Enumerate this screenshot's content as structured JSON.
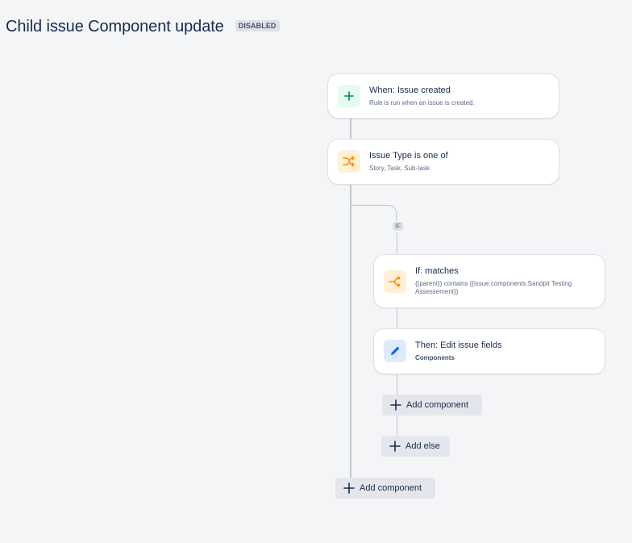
{
  "header": {
    "title": "Child issue Component update",
    "status": "DISABLED"
  },
  "flow": {
    "trigger": {
      "title": "When: Issue created",
      "subtitle": "Rule is run when an issue is created.",
      "icon": "plus-icon",
      "icon_color": "#00875a"
    },
    "condition": {
      "title": "Issue Type is one of",
      "subtitle": "Story, Task, Sub-task",
      "icon": "shuffle-icon",
      "icon_color": "#ff8b00"
    },
    "if_branch": {
      "badge": "IF",
      "condition": {
        "title": "If: matches",
        "subtitle": "{{parent}} contains {{issue.components.Sandpit Testing Assessement}}",
        "icon": "branch-icon",
        "icon_color": "#ff8b00"
      },
      "action": {
        "title": "Then: Edit issue fields",
        "subtitle": "Components",
        "icon": "pencil-icon",
        "icon_color": "#0052cc"
      },
      "add_component_label": "Add component",
      "add_else_label": "Add else"
    },
    "add_component_label": "Add component"
  }
}
